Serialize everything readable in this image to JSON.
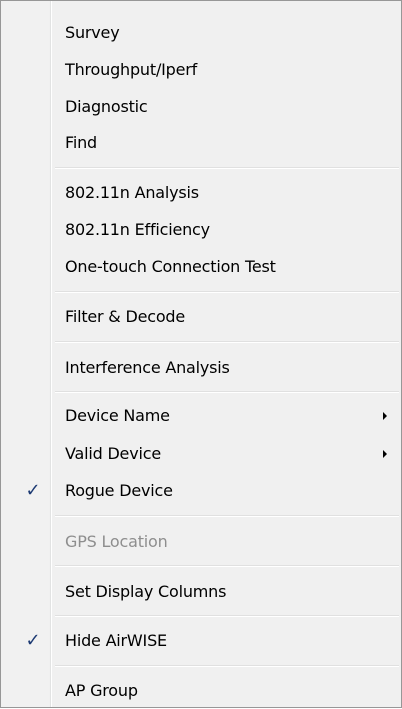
{
  "menu": {
    "items": [
      {
        "label": "Survey"
      },
      {
        "label": "Throughput/Iperf"
      },
      {
        "label": "Diagnostic"
      },
      {
        "label": "Find"
      },
      {
        "label": "802.11n Analysis"
      },
      {
        "label": "802.11n Efficiency"
      },
      {
        "label": "One-touch Connection Test"
      },
      {
        "label": "Filter & Decode"
      },
      {
        "label": "Interference Analysis"
      },
      {
        "label": "Device Name",
        "submenu": true
      },
      {
        "label": "Valid Device",
        "submenu": true
      },
      {
        "label": "Rogue Device",
        "checked": true
      },
      {
        "label": "GPS Location",
        "disabled": true
      },
      {
        "label": "Set Display Columns"
      },
      {
        "label": "Hide AirWISE",
        "checked": true
      },
      {
        "label": "AP Group"
      }
    ],
    "check_glyph": "✓",
    "colors": {
      "background": "#f0f0f0",
      "border": "#979797",
      "check": "#1d3a73",
      "disabled_text": "#8e8e8e"
    }
  }
}
